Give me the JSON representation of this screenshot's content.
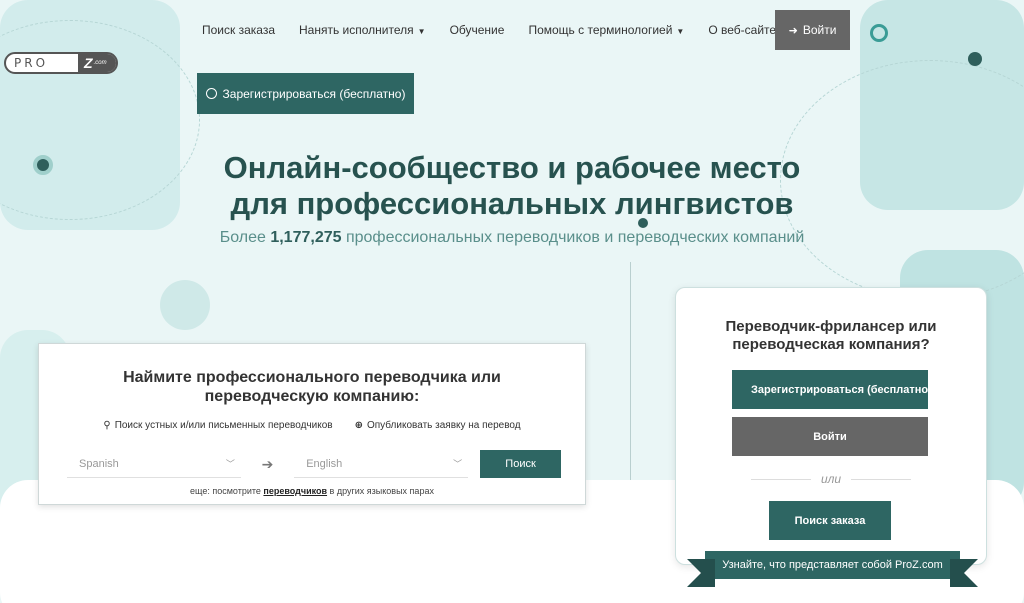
{
  "logo": {
    "pro": "PRO",
    "z": "Z",
    "com": ".com"
  },
  "nav": {
    "find_job": "Поиск заказа",
    "hire": "Нанять исполнителя",
    "training": "Обучение",
    "terminology": "Помощь с терминологией",
    "about": "О веб-сайте",
    "login": "Войти"
  },
  "register_top": "Зарегистрироваться (бесплатно)",
  "hero": {
    "title_line1": "Онлайн-сообщество и рабочее место",
    "title_line2": "для профессиональных лингвистов",
    "sub_prefix": "Более ",
    "sub_count": "1,177,275",
    "sub_suffix": " профессиональных переводчиков и переводческих компаний"
  },
  "search": {
    "title": "Наймите профессионального переводчика или переводческую компанию:",
    "option_search": "Поиск устных и/или письменных переводчиков",
    "option_post": "Опубликовать заявку на перевод",
    "source_lang": "Spanish",
    "target_lang": "English",
    "button": "Поиск",
    "note_prefix": "еще: посмотрите ",
    "note_link": "переводчиков",
    "note_suffix": " в других языковых парах"
  },
  "side": {
    "title": "Переводчик-фрилансер или переводческая компания?",
    "register": "Зарегистрироваться (бесплатно)",
    "login": "Войти",
    "or": "или",
    "find_job": "Поиск заказа",
    "ribbon": "Узнайте, что представляет собой ProZ.com"
  },
  "colors": {
    "accent": "#2e6663",
    "grey_button": "#666666",
    "title": "#27524f"
  }
}
